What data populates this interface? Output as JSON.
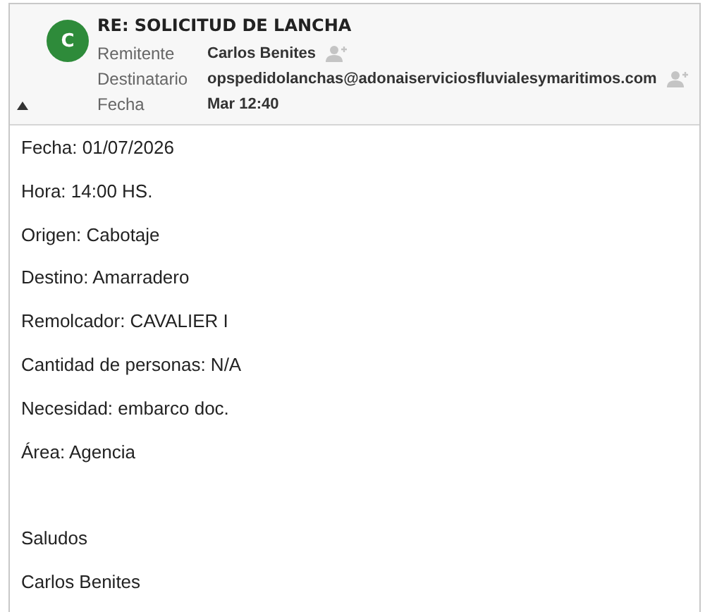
{
  "header": {
    "avatar": "C",
    "subject": "RE: SOLICITUD DE LANCHA",
    "expanded": true,
    "fields": [
      {
        "label": "Remitente",
        "value": "Carlos Benites",
        "add_contact": true
      },
      {
        "label": "Destinatario",
        "value": "opspedidolanchas@adonaiserviciosfluvialesymaritimos.com",
        "add_contact": true
      },
      {
        "label": "Fecha",
        "value": "Mar 12:40",
        "add_contact": false
      }
    ]
  },
  "body": {
    "lines": [
      "Fecha: 01/07/2026",
      "Hora: 14:00 HS.",
      "Origen: Cabotaje",
      "Destino: Amarradero",
      "Remolcador: CAVALIER I",
      "Cantidad de personas: N/A",
      "Necesidad: embarco doc.",
      "Área: Agencia"
    ],
    "signature": [
      "Saludos",
      "Carlos Benites"
    ]
  }
}
